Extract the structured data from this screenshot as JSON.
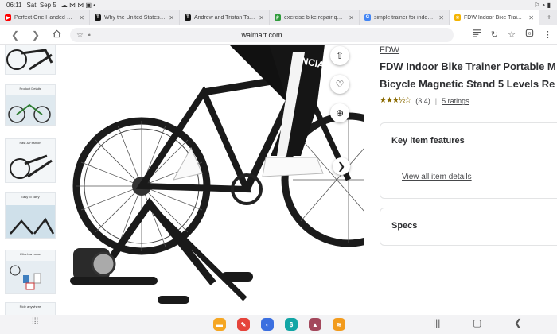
{
  "status": {
    "time": "06:11",
    "date": "Sat, Sep 5",
    "icons": "☁ ⋈ ⋈ ▣ •",
    "right": "⚐ ◔ ▮"
  },
  "tabs": [
    {
      "title": "Perfect One Handed Bac...",
      "fav": "▶",
      "fav_color": "#ff0000"
    },
    {
      "title": "Why the United States Ca...",
      "fav": "T",
      "fav_color": "#111111"
    },
    {
      "title": "Andrew and Tristan Tate:...",
      "fav": "T",
      "fav_color": "#111111"
    },
    {
      "title": "exercise bike repair ques...",
      "fav": "ρ",
      "fav_color": "#2e9b3a"
    },
    {
      "title": "simple trainer for indoor ...",
      "fav": "G",
      "fav_color": "#4285f4"
    },
    {
      "title": "FDW Indoor Bike Trai...",
      "fav": "✳",
      "fav_color": "#f4b400",
      "active": true
    }
  ],
  "tab_close": "✕",
  "new_tab": "+",
  "address": {
    "url": "walmart.com"
  },
  "product": {
    "brand": "FDW",
    "title_line1": "FDW Indoor Bike Trainer Portable M",
    "title_line2": "Bicycle Magnetic Stand 5 Levels Re",
    "rating_value": "(3.4)",
    "rating_stars": "★★★½☆",
    "ratings_link": "5 ratings",
    "separator": "|"
  },
  "cards": {
    "key_features": {
      "heading": "Key item features",
      "link": "View all item details"
    },
    "specs": {
      "heading": "Specs"
    }
  },
  "thumbnails": [
    {
      "caption": ""
    },
    {
      "caption": "Product Details"
    },
    {
      "caption": "Fast & Fashion"
    },
    {
      "caption": "Easy to carry"
    },
    {
      "caption": "Ultra low noise"
    },
    {
      "caption": "Ride anywhere"
    }
  ],
  "colors": {
    "walmart_blue": "#0071dc",
    "text": "#2e2f32",
    "star": "#8a6a00"
  }
}
